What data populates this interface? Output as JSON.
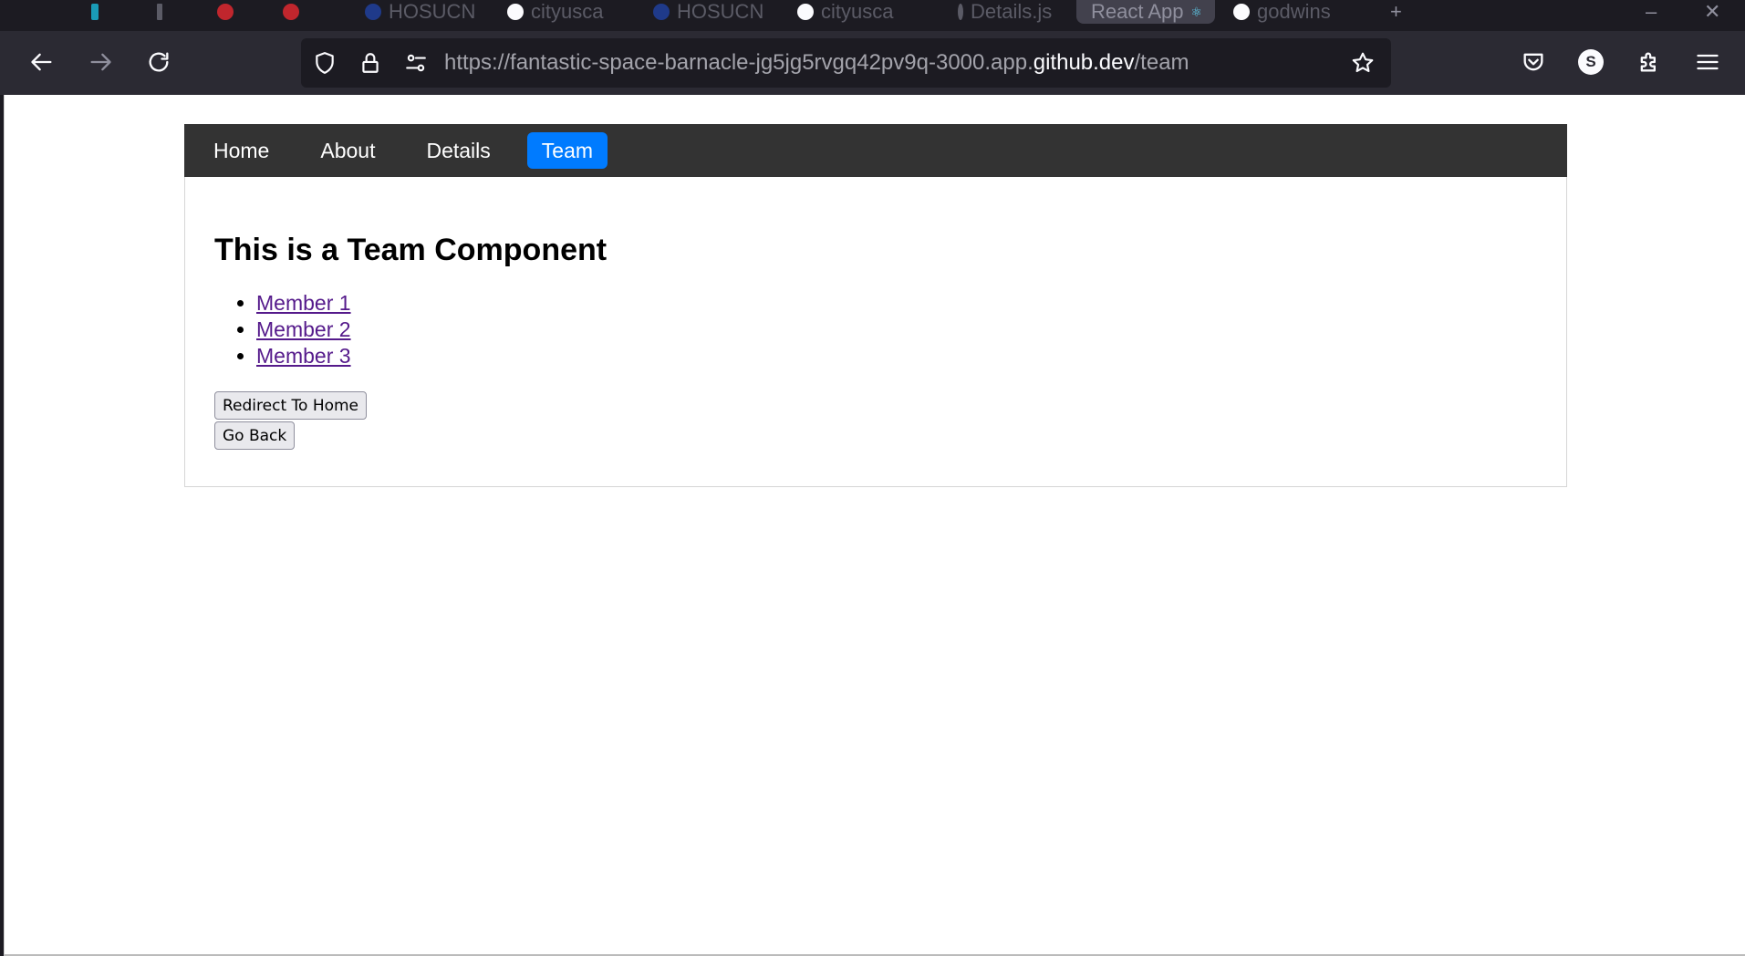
{
  "browser": {
    "tabs": [
      {
        "label": "",
        "color": "#1a9bb6"
      },
      {
        "label": "",
        "color": "#5b5b66"
      },
      {
        "label": "",
        "color": "#c0262d"
      },
      {
        "label": "",
        "color": "#c0262d"
      },
      {
        "label": "HOSUCN",
        "color": "#1f3a8a"
      },
      {
        "label": "cityusca",
        "color": "#fbfbfe"
      },
      {
        "label": "HOSUCN",
        "color": "#1f3a8a"
      },
      {
        "label": "cityusca",
        "color": "#fbfbfe"
      },
      {
        "label": "Details.js",
        "color": "#5b5b66"
      },
      {
        "label": "React App",
        "color": "#61dafb",
        "active": true
      },
      {
        "label": "godwins",
        "color": "#fbfbfe"
      }
    ],
    "url": {
      "prefix": "https://fantastic-space-barnacle-jg5jg5rvgq42pv9q-3000.app.",
      "host": "github.dev",
      "path": "/team"
    },
    "account_initial": "S"
  },
  "nav": {
    "home": "Home",
    "about": "About",
    "details": "Details",
    "team": "Team"
  },
  "page": {
    "heading": "This is a Team Component",
    "members": [
      "Member 1",
      "Member 2",
      "Member 3"
    ],
    "redirect_button": "Redirect To Home",
    "back_button": "Go Back"
  },
  "colors": {
    "nav_bg": "#333333",
    "nav_active": "#007bff",
    "link_visited": "#551a8b"
  }
}
